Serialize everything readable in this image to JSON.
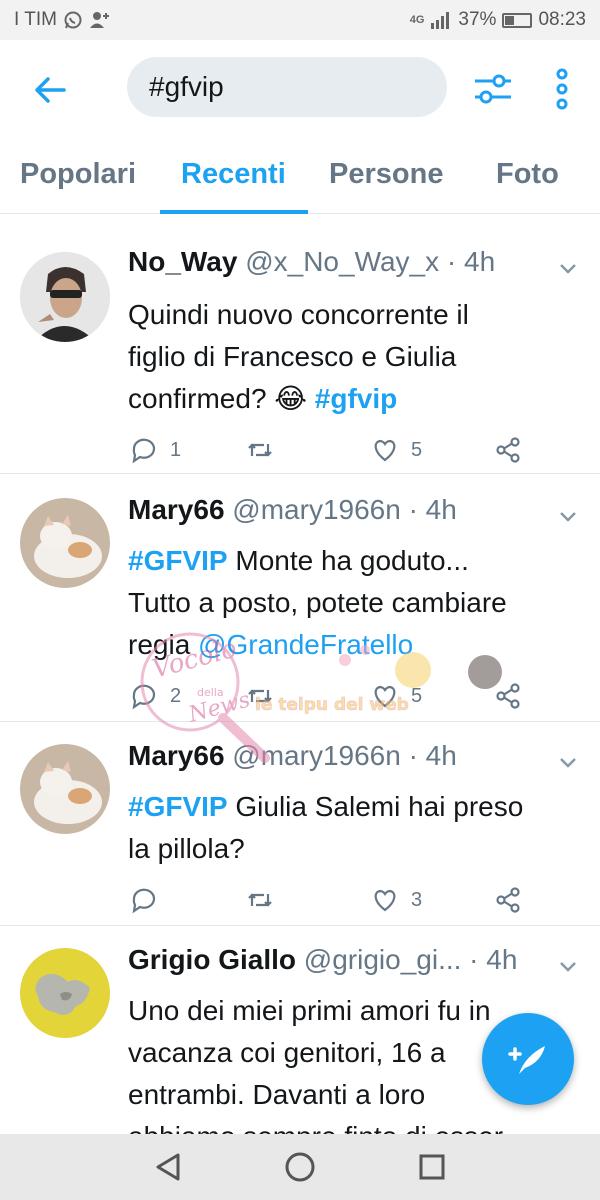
{
  "status_bar": {
    "carrier": "I TIM",
    "network": "4G",
    "battery_percent": "37%",
    "battery_level": 0.37,
    "time": "08:23"
  },
  "top_bar": {
    "search_value": "#gfvip",
    "icons": [
      "back-arrow-icon",
      "filter-sliders-icon",
      "more-vertical-icon"
    ]
  },
  "tabs": [
    {
      "label": "Popolari",
      "active": false
    },
    {
      "label": "Recenti",
      "active": true
    },
    {
      "label": "Persone",
      "active": false
    },
    {
      "label": "Foto",
      "active": false
    }
  ],
  "tweets": [
    {
      "name": "No_Way",
      "meta": "@x_No_Way_x · 4h",
      "text_lines": [
        "Quindi nuovo concorrente il",
        "figlio di Francesco e Giulia",
        "confirmed? 😂 "
      ],
      "hashtag": "#gfvip",
      "reply_count": "1",
      "like_count": "5"
    },
    {
      "name": "Mary66",
      "meta": "@mary1966n · 4h",
      "hashtag": "#GFVIP",
      "text_line1": " Monte ha goduto...",
      "text_line2": "Tutto a posto, potete cambiare",
      "text_line3": "regia ",
      "mention": "@GrandeFratello",
      "reply_count": "2",
      "like_count": "5"
    },
    {
      "name": "Mary66",
      "meta": "@mary1966n · 4h",
      "hashtag": "#GFVIP",
      "text_line1": " Giulia Salemi hai preso",
      "text_line2": "la pillola?",
      "reply_count": "",
      "like_count": "3"
    },
    {
      "name": "Grigio Giallo",
      "meta": "@grigio_gi... · 4h",
      "text_lines": [
        "Uno dei miei primi amori fu in",
        "vacanza coi genitori, 16 a",
        "entrambi. Davanti a loro",
        "abbiamo sempre finto di esser"
      ]
    }
  ],
  "watermark": {
    "script_text": "Vocolo",
    "small_text": "della",
    "news_text": "News",
    "banner_text": "le teipu del web"
  },
  "fab": {
    "icon": "compose-tweet-icon"
  },
  "nav_bar": {
    "icons": [
      "back-triangle-icon",
      "home-circle-icon",
      "recents-square-icon"
    ]
  }
}
